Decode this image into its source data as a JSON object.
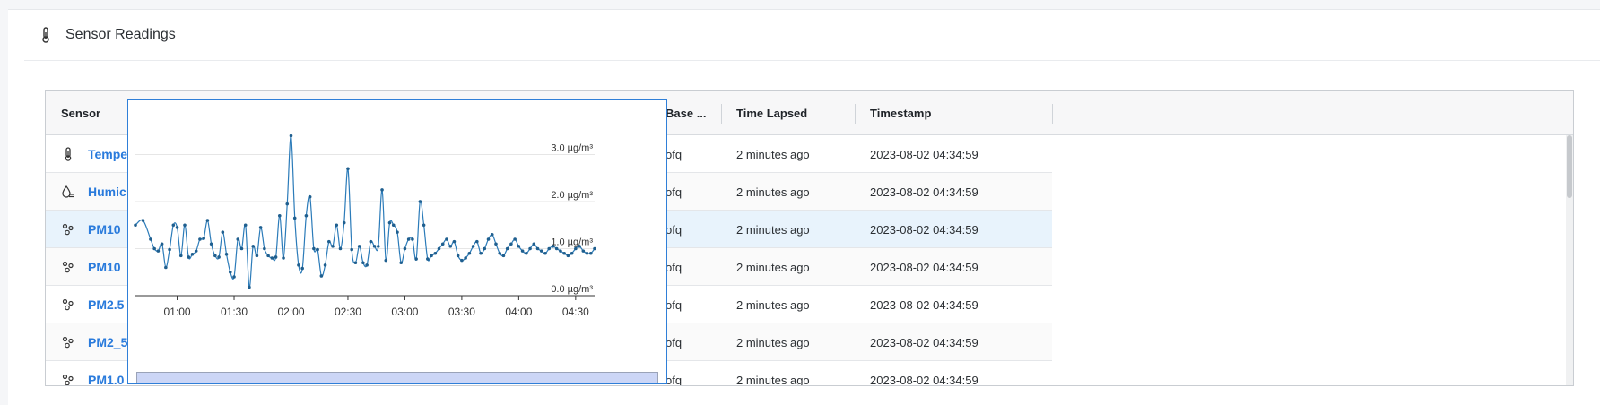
{
  "panel": {
    "title": "Sensor Readings",
    "icon": "thermometer-icon"
  },
  "table": {
    "columns": [
      "Sensor",
      "Base ...",
      "Time Lapsed",
      "Timestamp"
    ],
    "rows": [
      {
        "sensor": "Tempe",
        "icon": "thermometer-icon",
        "base": "ofq",
        "lapsed": "2 minutes ago",
        "timestamp": "2023-08-02 04:34:59"
      },
      {
        "sensor": "Humic",
        "icon": "humidity-icon",
        "base": "ofq",
        "lapsed": "2 minutes ago",
        "timestamp": "2023-08-02 04:34:59"
      },
      {
        "sensor": "PM10",
        "icon": "particles-icon",
        "base": "ofq",
        "lapsed": "2 minutes ago",
        "timestamp": "2023-08-02 04:34:59",
        "selected": true
      },
      {
        "sensor": "PM10",
        "icon": "particles-icon",
        "base": "ofq",
        "lapsed": "2 minutes ago",
        "timestamp": "2023-08-02 04:34:59"
      },
      {
        "sensor": "PM2.5",
        "icon": "particles-icon",
        "base": "ofq",
        "lapsed": "2 minutes ago",
        "timestamp": "2023-08-02 04:34:59"
      },
      {
        "sensor": "PM2_5",
        "icon": "particles-icon",
        "base": "ofq",
        "lapsed": "2 minutes ago",
        "timestamp": "2023-08-02 04:34:59"
      },
      {
        "sensor": "PM1.0",
        "icon": "particles-icon",
        "base": "ofq",
        "lapsed": "2 minutes ago",
        "timestamp": "2023-08-02 04:34:59"
      }
    ]
  },
  "colors": {
    "accent": "#2a7bdc",
    "line": "#2b7bb9",
    "selected_row": "#e8f3fc",
    "navigator": "#ccd6f6"
  },
  "chart_data": {
    "type": "line",
    "ylabel_unit": "µg/m³",
    "y_ticks": [
      "0.0 µg/m³",
      "1.0 µg/m³",
      "2.0 µg/m³",
      "3.0 µg/m³"
    ],
    "x_ticks": [
      "01:00",
      "01:30",
      "02:00",
      "02:30",
      "03:00",
      "03:30",
      "04:00",
      "04:30"
    ],
    "ylim": [
      0,
      4
    ],
    "xlim_minutes": [
      38,
      280
    ],
    "grid": true,
    "series": [
      {
        "x": [
          38,
          42,
          46,
          48,
          50,
          52,
          54,
          56,
          58,
          60,
          62,
          64,
          66,
          68,
          70,
          72,
          74,
          76,
          78,
          80,
          82,
          84,
          86,
          88,
          90,
          92,
          94,
          96,
          98,
          100,
          102,
          104,
          106,
          108,
          110,
          112,
          114,
          116,
          118,
          120,
          122,
          124,
          126,
          128,
          130,
          132,
          134,
          136,
          138,
          140,
          142,
          144,
          146,
          148,
          150,
          152,
          154,
          156,
          158,
          160,
          162,
          164,
          166,
          168,
          170,
          172,
          174,
          176,
          178,
          180,
          182,
          184,
          186,
          188,
          190,
          192,
          194,
          196,
          198,
          200,
          202,
          204,
          206,
          208,
          210,
          212,
          214,
          216,
          218,
          220,
          222,
          224,
          226,
          228,
          230,
          232,
          234,
          236,
          238,
          240,
          242,
          244,
          246,
          248,
          250,
          252,
          254,
          256,
          258,
          260,
          262,
          264,
          266,
          268,
          270,
          272,
          274,
          276,
          278,
          280
        ],
        "y": [
          1.5,
          1.6,
          1.2,
          1.0,
          0.95,
          1.1,
          0.6,
          0.98,
          1.5,
          1.45,
          0.85,
          1.5,
          0.82,
          0.88,
          0.95,
          1.2,
          1.22,
          1.6,
          1.1,
          0.85,
          0.82,
          1.35,
          0.88,
          0.5,
          0.4,
          1.2,
          1.0,
          1.5,
          0.18,
          1.05,
          0.85,
          1.45,
          1.0,
          0.85,
          0.8,
          0.82,
          1.7,
          0.8,
          1.95,
          3.4,
          1.65,
          0.65,
          0.58,
          1.7,
          2.1,
          1.0,
          0.98,
          0.42,
          0.65,
          1.15,
          1.05,
          1.5,
          1.0,
          1.55,
          2.7,
          0.98,
          0.7,
          1.05,
          0.7,
          0.65,
          1.15,
          1.05,
          1.05,
          2.25,
          0.75,
          1.55,
          1.5,
          1.35,
          0.7,
          1.0,
          1.2,
          1.2,
          0.78,
          2.0,
          1.5,
          0.78,
          0.85,
          0.9,
          1.0,
          1.1,
          1.2,
          1.05,
          1.15,
          0.85,
          0.75,
          0.8,
          0.9,
          1.05,
          1.15,
          0.9,
          1.0,
          1.2,
          1.3,
          1.1,
          0.9,
          0.85,
          1.0,
          1.1,
          1.2,
          1.05,
          0.95,
          0.9,
          1.0,
          1.1,
          1.0,
          0.95,
          0.9,
          1.0,
          1.05,
          1.0,
          0.95,
          0.9,
          0.85,
          0.9,
          1.0,
          1.05,
          0.95,
          0.9,
          0.9,
          1.0
        ]
      }
    ]
  }
}
